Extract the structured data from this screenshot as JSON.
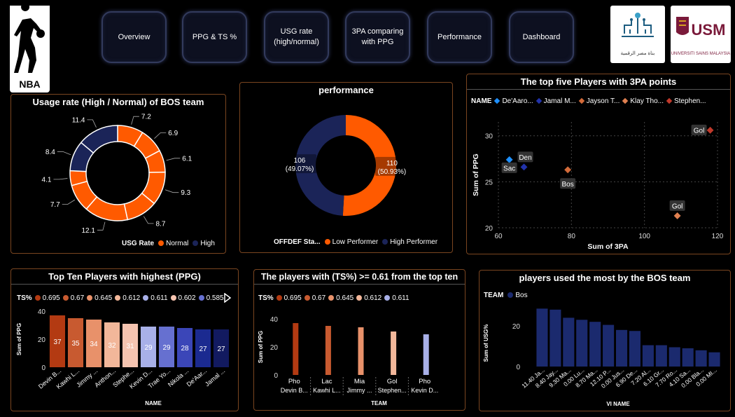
{
  "nav": {
    "overview": "Overview",
    "ppg_ts": "PPG & TS %",
    "usg": "USG rate\n(high/normal)",
    "threepa": "3PA comparing\nwith PPG",
    "performance": "Performance",
    "dashboard": "Dashboard"
  },
  "logos": {
    "nba": "NBA",
    "left_org": "بناة مصر الرقمية",
    "usm": "UNIVERSITI SAINS MALAYSIA",
    "usm_short": "USM"
  },
  "colors": {
    "orange": "#ff5a00",
    "navy": "#1b2458",
    "panel_border": "#7a4520"
  },
  "chart_data": [
    {
      "id": "usage",
      "type": "pie",
      "title": "Usage rate (High / Normal) of BOS team",
      "legend_title": "USG Rate",
      "legend": [
        "Normal",
        "High"
      ],
      "slices": [
        {
          "value": 7.2,
          "label": "7.2",
          "series": "Normal"
        },
        {
          "value": 6.9,
          "label": "6.9",
          "series": "Normal"
        },
        {
          "value": 6.1,
          "label": "6.1",
          "series": "Normal"
        },
        {
          "value": 9.3,
          "label": "9.3",
          "series": "Normal"
        },
        {
          "value": 8.7,
          "label": "8.7",
          "series": "Normal"
        },
        {
          "value": 12.1,
          "label": "12.1",
          "series": "Normal"
        },
        {
          "value": 7.7,
          "label": "7.7",
          "series": "Normal"
        },
        {
          "value": 4.1,
          "label": "4.1",
          "series": "Normal"
        },
        {
          "value": 8.4,
          "label": "8.4",
          "series": "High"
        },
        {
          "value": 11.4,
          "label": "11.4",
          "series": "High"
        }
      ]
    },
    {
      "id": "performance",
      "type": "pie",
      "title": "performance",
      "legend_title": "OFFDEF Sta...",
      "legend": [
        "Low Performer",
        "High Performer"
      ],
      "slices": [
        {
          "value": 110,
          "label": "110",
          "pct": "(50.93%)",
          "series": "Low Performer"
        },
        {
          "value": 106,
          "label": "106",
          "pct": "(49.07%)",
          "series": "High Performer"
        }
      ]
    },
    {
      "id": "threepa",
      "type": "scatter",
      "title": "The top five Players with 3PA points",
      "legend_title": "NAME",
      "xlabel": "Sum of 3PA",
      "ylabel": "Sum of PPG",
      "xlim": [
        60,
        120
      ],
      "ylim": [
        20,
        31.5
      ],
      "xticks": [
        60,
        80,
        100,
        120
      ],
      "yticks": [
        20,
        25,
        30
      ],
      "series": [
        {
          "name": "De'Aaro...",
          "color": "#1e90ff",
          "points": [
            {
              "x": 63,
              "y": 27.4,
              "label": "Sac"
            }
          ]
        },
        {
          "name": "Jamal M...",
          "color": "#2233aa",
          "points": [
            {
              "x": 67,
              "y": 26.6,
              "label": "Den"
            }
          ]
        },
        {
          "name": "Jayson T...",
          "color": "#d36b3a",
          "points": [
            {
              "x": 79,
              "y": 26.3,
              "label": "Bos"
            }
          ]
        },
        {
          "name": "Klay Tho...",
          "color": "#e08050",
          "points": [
            {
              "x": 109,
              "y": 21.3,
              "label": "Gol"
            }
          ]
        },
        {
          "name": "Stephen...",
          "color": "#c0392b",
          "points": [
            {
              "x": 118,
              "y": 30.6,
              "label": "Gol"
            }
          ]
        }
      ]
    },
    {
      "id": "ppg",
      "type": "bar",
      "title": "Top Ten Players with highest (PPG)",
      "legend_title": "TS%",
      "legend": [
        {
          "label": "0.695",
          "color": "#b33a12"
        },
        {
          "label": "0.67",
          "color": "#c85a30"
        },
        {
          "label": "0.645",
          "color": "#e8916a"
        },
        {
          "label": "0.612",
          "color": "#f2b79a"
        },
        {
          "label": "0.611",
          "color": "#a8b0e8"
        },
        {
          "label": "0.602",
          "color": "#f5c4b0"
        },
        {
          "label": "0.585",
          "color": "#6670d0"
        }
      ],
      "xlabel": "NAME",
      "ylabel": "Sum of PPG",
      "ylim": [
        0,
        40
      ],
      "yticks": [
        0,
        20,
        40
      ],
      "categories": [
        "Devin B...",
        "Kawhi L...",
        "Jimmy ...",
        "Anthon...",
        "Stephe...",
        "Kevin D...",
        "Trae Yo...",
        "Nikola ...",
        "De'Aar...",
        "Jamal ..."
      ],
      "values": [
        37,
        35,
        34,
        32,
        31,
        29,
        29,
        28,
        27,
        27
      ],
      "colors": [
        "#b33a12",
        "#c85a30",
        "#e8916a",
        "#f2b79a",
        "#f5c4b0",
        "#a8b0e8",
        "#6670d0",
        "#3b46b8",
        "#1b2a90",
        "#121a60"
      ]
    },
    {
      "id": "ts",
      "type": "bar",
      "title": "The players with (TS%) >= 0.61 from the top ten",
      "legend_title": "TS%",
      "legend": [
        {
          "label": "0.695",
          "color": "#b33a12"
        },
        {
          "label": "0.67",
          "color": "#c85a30"
        },
        {
          "label": "0.645",
          "color": "#e8916a"
        },
        {
          "label": "0.612",
          "color": "#f2b79a"
        },
        {
          "label": "0.611",
          "color": "#a8b0e8"
        }
      ],
      "xlabel": "TEAM",
      "ylabel": "Sum of PPG",
      "ylim": [
        0,
        40
      ],
      "yticks": [
        0,
        20,
        40
      ],
      "categories": [
        {
          "team": "Pho",
          "name": "Devin B..."
        },
        {
          "team": "Lac",
          "name": "Kawhi L..."
        },
        {
          "team": "Mia",
          "name": "Jimmy ..."
        },
        {
          "team": "Gol",
          "name": "Stephen..."
        },
        {
          "team": "Pho",
          "name": "Kevin D..."
        }
      ],
      "values": [
        37,
        35,
        34,
        31,
        29
      ],
      "colors": [
        "#b33a12",
        "#c85a30",
        "#e8916a",
        "#f2b79a",
        "#a8b0e8"
      ]
    },
    {
      "id": "bos",
      "type": "bar",
      "title": "players used the most by the BOS team",
      "legend_title": "TEAM",
      "legend": [
        {
          "label": "Bos",
          "color": "#1b2a6e"
        }
      ],
      "xlabel": "VI NAME",
      "ylabel": "Sum of USG%",
      "ylim": [
        0,
        30
      ],
      "yticks": [
        0,
        20
      ],
      "categories": [
        "11.40 Ja...",
        "8.40 Jay...",
        "9.30 Ma...",
        "0.00 Lu...",
        "8.70 Ma...",
        "12.10 P...",
        "0.00 Jus...",
        "6.90 De...",
        "7.20 Al...",
        "6.10 Gr...",
        "7.70 Ro...",
        "4.10 Sa...",
        "0.00 Bla...",
        "0.00 MI..."
      ],
      "values": [
        28.5,
        28,
        24,
        23,
        22,
        20.5,
        18,
        17.5,
        10.5,
        10.5,
        9.5,
        9,
        8,
        7
      ]
    }
  ]
}
